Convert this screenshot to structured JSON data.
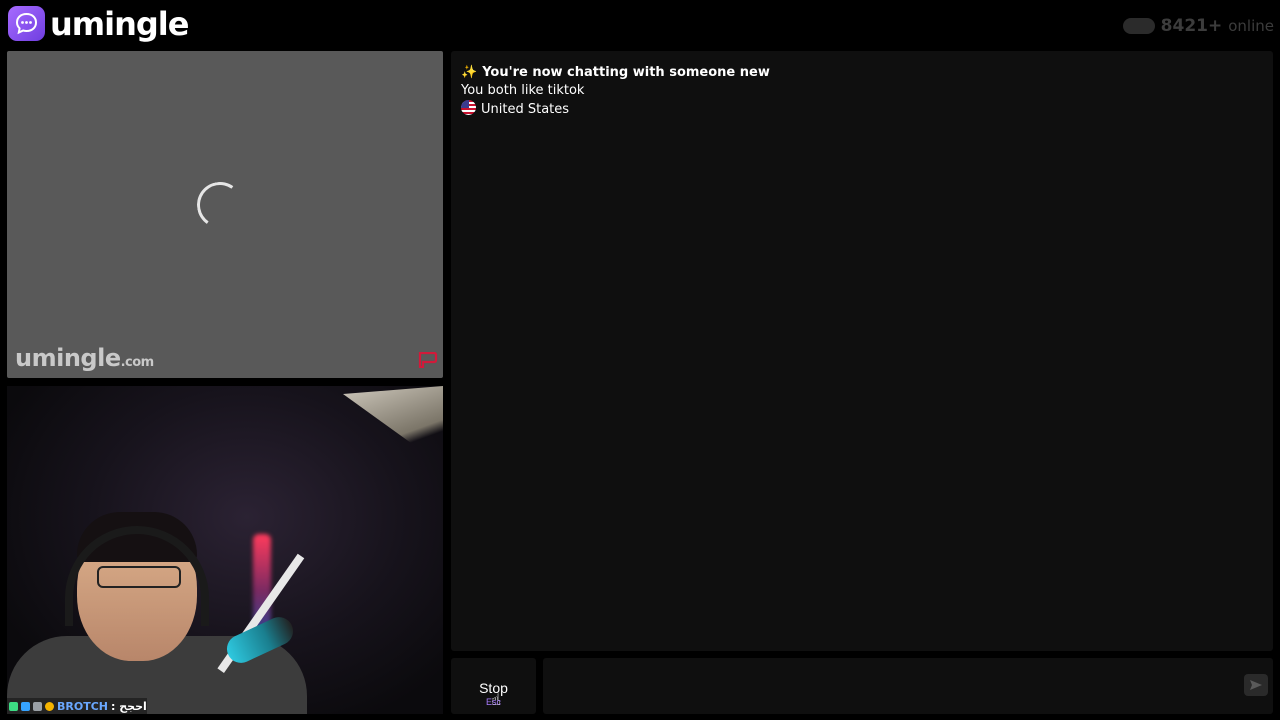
{
  "header": {
    "logo_text": "umingle",
    "online_count": "8421+",
    "online_label": "online"
  },
  "partner_video": {
    "watermark_brand": "umingle",
    "watermark_domain": ".com"
  },
  "self_video": {
    "overlay_username": "BROTCH",
    "overlay_message": ": احجح"
  },
  "chat": {
    "headline": "You're now chatting with someone new",
    "common_interest": "You both like tiktok",
    "country": "United States"
  },
  "controls": {
    "stop_label": "Stop",
    "stop_shortcut": "Esc",
    "message_placeholder": ""
  },
  "colors": {
    "accent": "#8b5cf6",
    "background": "#000000",
    "panel": "#0f0f0f",
    "video_placeholder": "#595959"
  }
}
